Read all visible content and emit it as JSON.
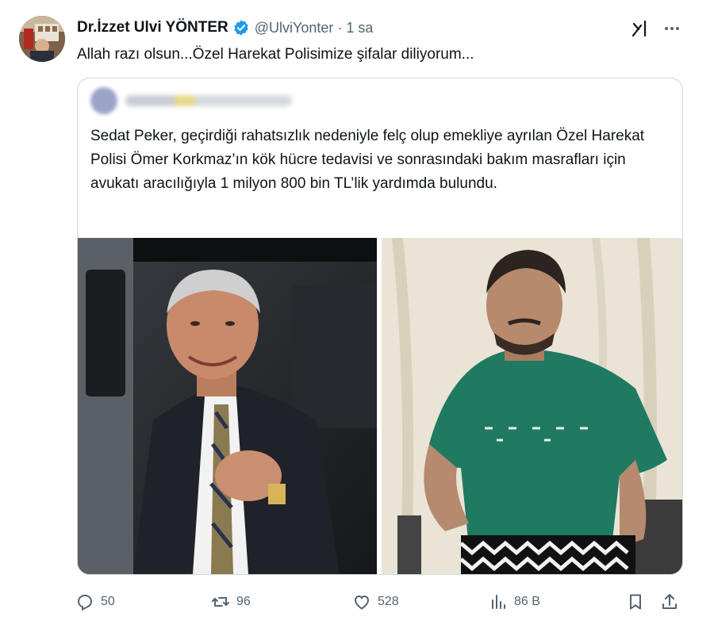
{
  "author": {
    "name": "Dr.İzzet Ulvi YÖNTER",
    "handle": "@UlviYonter",
    "separator": "·",
    "time": "1 sa"
  },
  "tweet_text": "Allah razı olsun...Özel Harekat Polisimize şifalar diliyorum...",
  "quoted": {
    "text": "Sedat Peker, geçirdiği rahatsızlık nedeniyle felç olup emekliye ayrılan Özel Harekat Polisi Ömer Korkmaz’ın kök hücre tedavisi ve sonrasındaki bakım masrafları için avukatı aracılığıyla 1 milyon 800 bin TL’lik yardımda bulundu."
  },
  "actions": {
    "replies": "50",
    "retweets": "96",
    "likes": "528",
    "views": "86 B"
  },
  "colors": {
    "text": "#0f1419",
    "muted": "#536471",
    "border": "#cfd9de",
    "verified": "#1d9bf0"
  },
  "icons": [
    "verified-badge-icon",
    "grok-icon",
    "more-icon",
    "reply-icon",
    "retweet-icon",
    "like-icon",
    "views-icon",
    "bookmark-icon",
    "share-icon"
  ]
}
